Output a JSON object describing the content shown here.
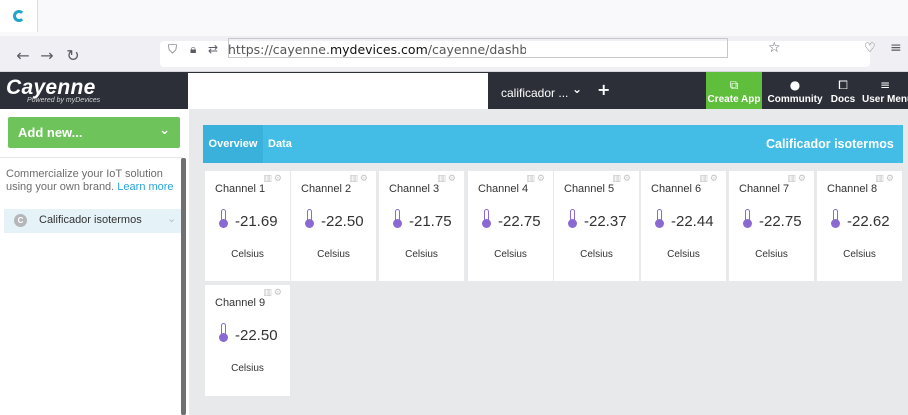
{
  "browser": {
    "url_prefix": "https://cayenne.",
    "url_domain": "mydevices.com",
    "url_path": "/cayenne/dashboard/device/("
  },
  "app": {
    "logo": "Cayenne",
    "logo_sub": "Powered by myDevices",
    "device_select": "calificador ...",
    "create_app": "Create App",
    "community": "Community",
    "docs": "Docs",
    "user_menu": "User Menu"
  },
  "sidebar": {
    "add_new": "Add new...",
    "promo_text": "Commercialize your IoT solution using your own brand.",
    "promo_link": "Learn more",
    "device_label": "Calificador isotermos"
  },
  "dashboard": {
    "tabs": [
      "Overview",
      "Data"
    ],
    "title": "Calificador isotermos"
  },
  "colors": {
    "accent_blue": "#43bde6",
    "accent_green": "#6ec35a",
    "header_dark": "#2c2f38",
    "thermometer": "#8a6ad2"
  },
  "widgets": [
    {
      "name": "Channel 1",
      "value": "-21.69",
      "unit": "Celsius"
    },
    {
      "name": "Channel 2",
      "value": "-22.50",
      "unit": "Celsius"
    },
    {
      "name": "Channel 3",
      "value": "-21.75",
      "unit": "Celsius"
    },
    {
      "name": "Channel 4",
      "value": "-22.75",
      "unit": "Celsius"
    },
    {
      "name": "Channel 5",
      "value": "-22.37",
      "unit": "Celsius"
    },
    {
      "name": "Channel 6",
      "value": "-22.44",
      "unit": "Celsius"
    },
    {
      "name": "Channel 7",
      "value": "-22.75",
      "unit": "Celsius"
    },
    {
      "name": "Channel 8",
      "value": "-22.62",
      "unit": "Celsius"
    },
    {
      "name": "Channel 9",
      "value": "-22.50",
      "unit": "Celsius"
    }
  ]
}
